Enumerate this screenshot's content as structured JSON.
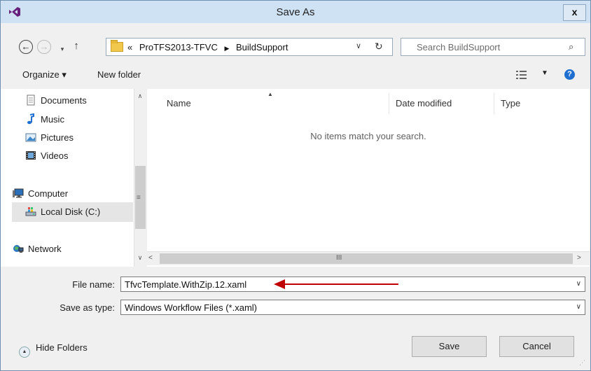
{
  "title": "Save As",
  "close_glyph": "x",
  "nav": {
    "back_glyph": "←",
    "forward_glyph": "→",
    "recent_glyph": "▾",
    "up_glyph": "↑",
    "breadcrumb": [
      "«",
      "ProTFS2013-TFVC",
      "▶",
      "BuildSupport"
    ],
    "dropdown_glyph": "∨",
    "refresh_glyph": "↻",
    "search_placeholder": "Search BuildSupport",
    "search_glyph": "⌕"
  },
  "toolbar": {
    "organize_label": "Organize ▾",
    "new_folder_label": "New folder",
    "view_dd_glyph": "▼",
    "help_glyph": "?"
  },
  "sidebar": {
    "documents": "Documents",
    "music": "Music",
    "pictures": "Pictures",
    "videos": "Videos",
    "computer": "Computer",
    "local_disk": "Local Disk (C:)",
    "network": "Network"
  },
  "scroll": {
    "up": "∧",
    "down": "∨",
    "left": "<",
    "right": ">",
    "vgrip": "≡",
    "hgrip": "III"
  },
  "columns": {
    "name": "Name",
    "sort_glyph": "▲",
    "date_modified": "Date modified",
    "type": "Type"
  },
  "empty_message": "No items match your search.",
  "form": {
    "file_name_label": "File name:",
    "file_name_value": "TfvcTemplate.WithZip.12.xaml",
    "save_type_label": "Save as type:",
    "save_type_value": "Windows Workflow Files (*.xaml)",
    "dropdown_glyph": "∨"
  },
  "footer": {
    "hide_folders_label": "Hide Folders",
    "hide_folders_glyph": "▲",
    "save_label": "Save",
    "cancel_label": "Cancel"
  },
  "colors": {
    "annotation_arrow": "#c00000",
    "titlebar": "#cfe2f3"
  }
}
